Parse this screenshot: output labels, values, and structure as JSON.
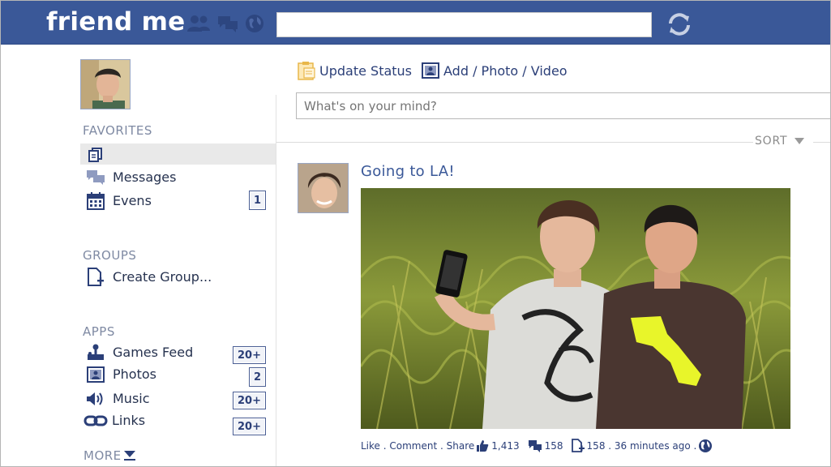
{
  "app": {
    "logo": "friend me"
  },
  "search": {
    "value": "",
    "placeholder": ""
  },
  "sidebar": {
    "favorites_title": "FAVORITES",
    "favorites": [
      {
        "label": "",
        "icon": "news-feed-icon",
        "selected": true
      },
      {
        "label": "Messages",
        "icon": "messages-icon"
      },
      {
        "label": "Evens",
        "icon": "calendar-icon",
        "badge": "1"
      }
    ],
    "groups_title": "GROUPS",
    "groups": [
      {
        "label": "Create Group...",
        "icon": "create-group-icon"
      }
    ],
    "apps_title": "APPS",
    "apps": [
      {
        "label": "Games Feed",
        "icon": "joystick-icon",
        "badge": "20+"
      },
      {
        "label": "Photos",
        "icon": "photos-icon",
        "badge": "2"
      },
      {
        "label": "Music",
        "icon": "speaker-icon",
        "badge": "20+"
      },
      {
        "label": "Links",
        "icon": "link-icon",
        "badge": "20+"
      }
    ],
    "more_label": "MORE"
  },
  "composer": {
    "update_status": "Update Status",
    "add_media": "Add / Photo / Video",
    "placeholder": "What's on your mind?"
  },
  "feed": {
    "sort_label": "SORT",
    "post": {
      "title": "Going to LA!",
      "like": "Like",
      "comment": "Comment",
      "share": "Share",
      "likes_count": "1,413",
      "comments_count": "158",
      "shares_count": "158",
      "time": "36 minutes ago"
    }
  },
  "colors": {
    "brand": "#3a5898",
    "badge_border": "#4a5e94",
    "section_title": "#7f8aa3"
  }
}
